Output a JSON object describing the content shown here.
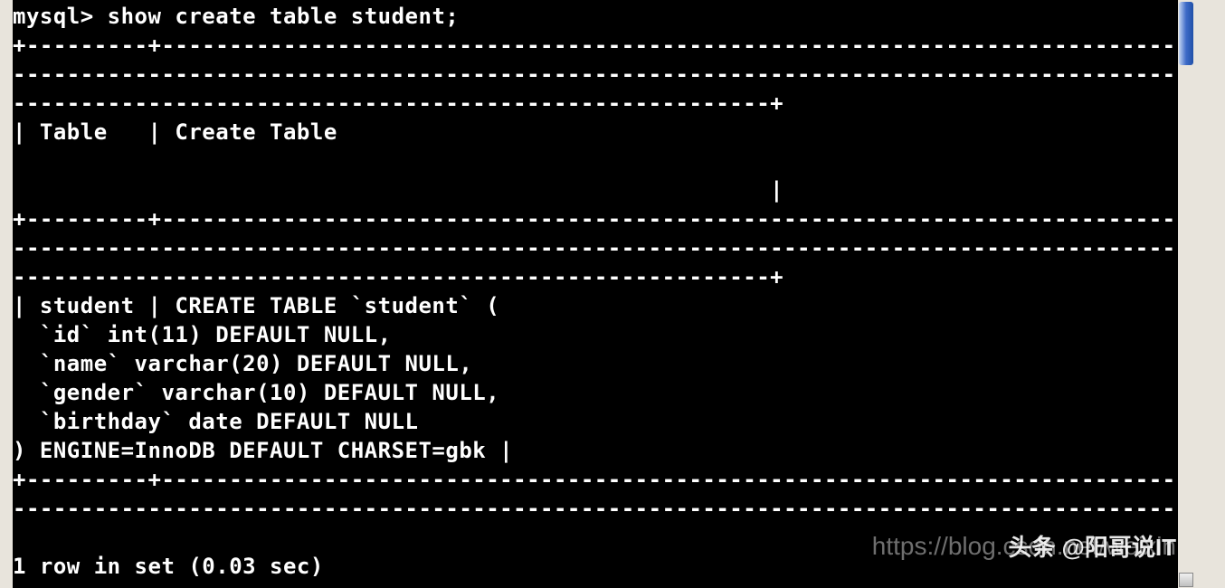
{
  "terminal": {
    "prompt": "mysql>",
    "command": "show create table student;",
    "border_top1": "+---------+-------------------------------------------------------------------------------------",
    "border_dash_line": "------------------------------------------------------------------------------------------------",
    "border_end_short": "--------------------------------------------------------+",
    "header": "| Table   | Create Table",
    "header_spacer_pipe": "                                                        |",
    "border_mid": "+---------+-------------------------------------------------------------------------------------",
    "row1": "| student | CREATE TABLE `student` (",
    "row2": "  `id` int(11) DEFAULT NULL,",
    "row3": "  `name` varchar(20) DEFAULT NULL,",
    "row4": "  `gender` varchar(10) DEFAULT NULL,",
    "row5": "  `birthday` date DEFAULT NULL",
    "row6": ") ENGINE=InnoDB DEFAULT CHARSET=gbk |",
    "border_bottom": "+---------+-------------------------------------------------------------------------------------",
    "result": "1 row in set (0.03 sec)"
  },
  "watermark": {
    "url": "https://blog.csdn.net/weixin",
    "toutiao": "头条 @阳哥说IT"
  }
}
